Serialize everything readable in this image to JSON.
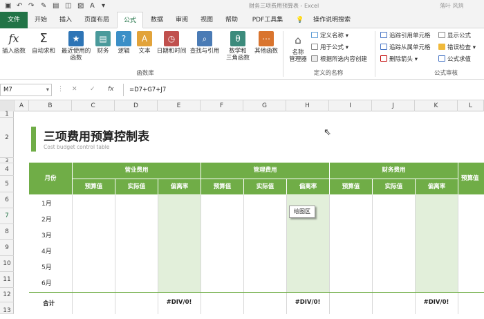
{
  "window": {
    "title": "财务三项费用预算表  -  Excel",
    "user": "落叶 风鸩"
  },
  "tabs": [
    "文件",
    "开始",
    "插入",
    "页面布局",
    "公式",
    "数据",
    "审阅",
    "视图",
    "帮助",
    "PDF工具集",
    "操作说明搜索"
  ],
  "ribbon": {
    "insert_function": "插入函数",
    "autosum": "自动求和",
    "recent_1": "最近使用的",
    "recent_2": "函数",
    "finance": "财务",
    "logic": "逻辑",
    "text": "文本",
    "datetime": "日期和时间",
    "lookup": "查找与引用",
    "math_1": "数学和",
    "math_2": "三角函数",
    "other": "其他函数",
    "group_library": "函数库",
    "name_mgr_1": "名称",
    "name_mgr_2": "管理器",
    "define_name": "定义名称",
    "use_in_formula": "用于公式",
    "create_from_sel": "根据所选内容创建",
    "group_names": "定义的名称",
    "trace_precedents": "追踪引用单元格",
    "trace_dependents": "追踪从属单元格",
    "remove_arrows": "删除箭头",
    "show_formulas": "显示公式",
    "error_check": "错误检查",
    "evaluate": "公式求值",
    "group_audit": "公式审核"
  },
  "formula_bar": {
    "name_box": "M7",
    "fx": "fx",
    "formula": "=D7+G7+J7"
  },
  "columns": [
    "A",
    "B",
    "C",
    "D",
    "E",
    "F",
    "G",
    "H",
    "I",
    "J",
    "K",
    "L"
  ],
  "rows": [
    "1",
    "2",
    "3",
    "4",
    "5",
    "6",
    "7",
    "8",
    "9",
    "10",
    "11",
    "12",
    "13"
  ],
  "sheet": {
    "title": "三项费用预算控制表",
    "subtitle": "Cost budget control table",
    "month_header": "月份",
    "groups": [
      "营业费用",
      "管理费用",
      "财务费用",
      "预算值"
    ],
    "subheaders": [
      "预算值",
      "实际值",
      "偏离率"
    ],
    "months": [
      "1月",
      "2月",
      "3月",
      "4月",
      "5月",
      "6月"
    ],
    "total_label": "合计",
    "errors": [
      "#DIV/0!",
      "#DIV/0!",
      "#DIV/0!"
    ],
    "tooltip": "绘图区"
  },
  "colors": {
    "accent": "#217346",
    "header_green": "#70ad47",
    "light_green": "#e2efda"
  }
}
